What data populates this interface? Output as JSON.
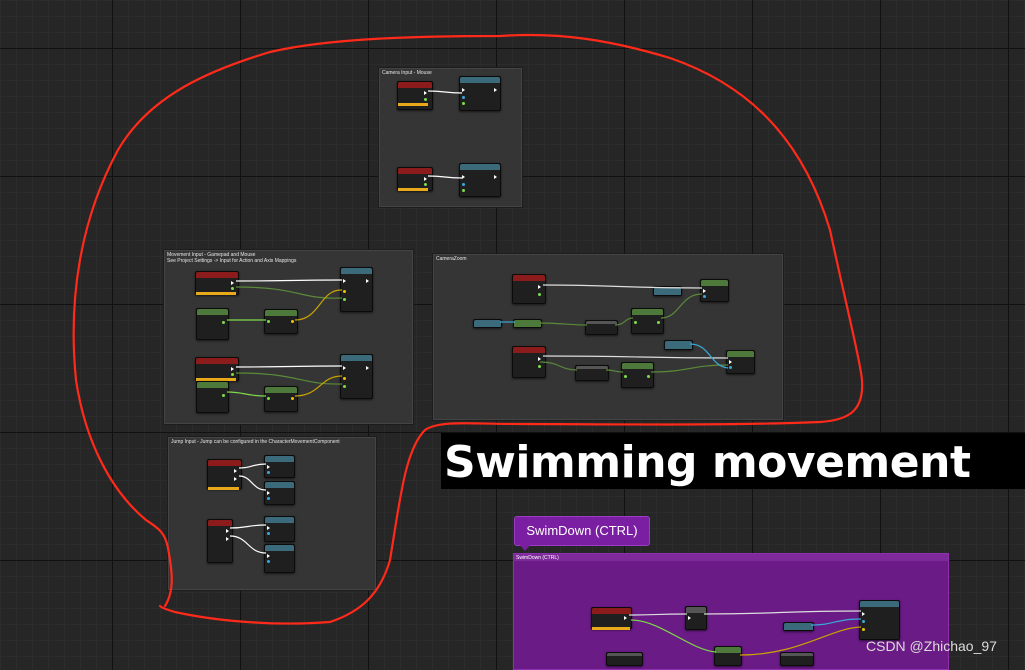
{
  "comments": {
    "camera_input": "Camera Input - Mouse",
    "movement_input": "Movement Input - Gamepad and Mouse\nSee Project Settings -> Input for Action and Axis Mappings",
    "camera_zoom": "CameraZoom",
    "jump_input": "Jump Input - Jump can be configured in the CharacterMovementComponent",
    "swim_down": "SwimDown (CTRL)"
  },
  "banner": {
    "title": "Swimming movement"
  },
  "swim_bubble": {
    "label": "SwimDown  (CTRL)"
  },
  "watermark": "CSDN @Zhichao_97",
  "colors": {
    "annotation": "#ff2a1a",
    "swim_purple": "#6a1b85",
    "event_red": "#8c1c1c",
    "exec_wire": "#ffffff",
    "float_wire": "#7ddc4a",
    "vector_wire": "#f2c200"
  }
}
